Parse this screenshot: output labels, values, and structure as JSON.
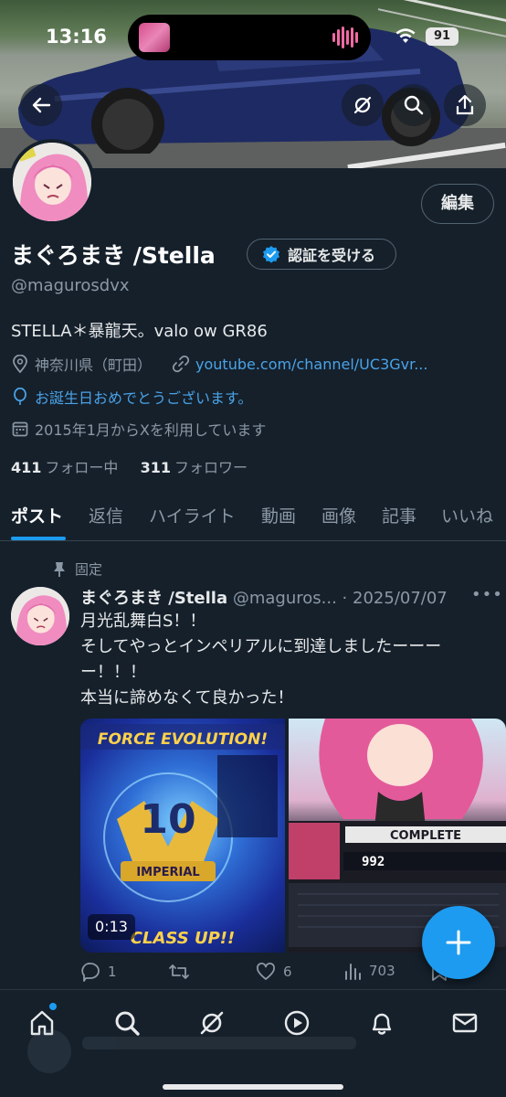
{
  "status_bar": {
    "time": "13:16",
    "battery": "91"
  },
  "profile": {
    "name": "まぐろまき /Stella",
    "verify_label": "認証を受ける",
    "edit_label": "編集",
    "handle": "@magurosdvx",
    "bio": "STELLA＊暴龍天。valo ow GR86",
    "location": "神奈川県（町田）",
    "link": "youtube.com/channel/UC3Gvr...",
    "birthday": "お誕生日おめでとうございます。",
    "joined": "2015年1月からXを利用しています",
    "following_count": "411",
    "following_label": "フォロー中",
    "followers_count": "311",
    "followers_label": "フォロワー"
  },
  "tabs": [
    {
      "label": "ポスト",
      "active": true
    },
    {
      "label": "返信"
    },
    {
      "label": "ハイライト"
    },
    {
      "label": "動画"
    },
    {
      "label": "画像"
    },
    {
      "label": "記事"
    },
    {
      "label": "いいね"
    }
  ],
  "post": {
    "pinned_label": "固定",
    "author_name": "まぐろまき /Stella",
    "author_handle": "@maguros...",
    "separator": "·",
    "date": "2025/07/07",
    "text": "月光乱舞白S！！\nそしてやっとインペリアルに到達しましたーーーー！！！\n本当に諦めなくて良かった！",
    "video_duration": "0:13",
    "replies": "1",
    "likes": "6",
    "views": "703"
  },
  "colors": {
    "accent": "#1d9bf0",
    "background": "#15202b",
    "link": "#4aa3e8"
  },
  "icons": {
    "back": "arrow-left-icon",
    "grok": "grok-icon",
    "search": "search-icon",
    "share": "share-icon",
    "verify": "verified-badge-icon",
    "location": "location-pin-icon",
    "link": "link-icon",
    "birthday": "balloon-icon",
    "calendar": "calendar-icon",
    "pin": "pin-icon",
    "reply": "reply-icon",
    "repost": "repost-icon",
    "like": "heart-icon",
    "views": "views-icon",
    "bookmark": "bookmark-icon",
    "compose": "plus-icon",
    "nav": [
      "home-icon",
      "search-icon",
      "grok-icon",
      "play-icon",
      "bell-icon",
      "mail-icon"
    ]
  }
}
